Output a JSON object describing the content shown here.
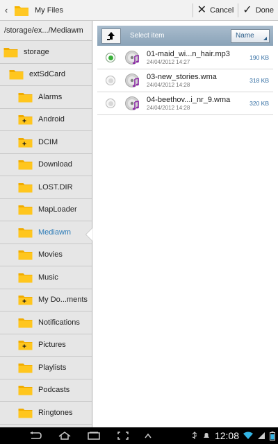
{
  "app": {
    "title": "My Files",
    "cancel_label": "Cancel",
    "done_label": "Done"
  },
  "tree": {
    "path": "/storage/ex.../Mediawm",
    "items": [
      {
        "label": "storage",
        "level": 0,
        "plus": false,
        "selected": false
      },
      {
        "label": "extSdCard",
        "level": 1,
        "plus": false,
        "selected": false
      },
      {
        "label": "Alarms",
        "level": 2,
        "plus": false,
        "selected": false
      },
      {
        "label": "Android",
        "level": 2,
        "plus": true,
        "selected": false
      },
      {
        "label": "DCIM",
        "level": 2,
        "plus": true,
        "selected": false
      },
      {
        "label": "Download",
        "level": 2,
        "plus": false,
        "selected": false
      },
      {
        "label": "LOST.DIR",
        "level": 2,
        "plus": false,
        "selected": false
      },
      {
        "label": "MapLoader",
        "level": 2,
        "plus": false,
        "selected": false
      },
      {
        "label": "Mediawm",
        "level": 2,
        "plus": false,
        "selected": true
      },
      {
        "label": "Movies",
        "level": 2,
        "plus": false,
        "selected": false
      },
      {
        "label": "Music",
        "level": 2,
        "plus": false,
        "selected": false
      },
      {
        "label": "My Do...ments",
        "level": 2,
        "plus": true,
        "selected": false
      },
      {
        "label": "Notifications",
        "level": 2,
        "plus": false,
        "selected": false
      },
      {
        "label": "Pictures",
        "level": 2,
        "plus": true,
        "selected": false
      },
      {
        "label": "Playlists",
        "level": 2,
        "plus": false,
        "selected": false
      },
      {
        "label": "Podcasts",
        "level": 2,
        "plus": false,
        "selected": false
      },
      {
        "label": "Ringtones",
        "level": 2,
        "plus": false,
        "selected": false
      }
    ]
  },
  "list": {
    "header_label": "Select item",
    "sort_label": "Name",
    "files": [
      {
        "name": "01-maid_wi...n_hair.mp3",
        "date": "24/04/2012 14:27",
        "size": "190 KB",
        "selected": true
      },
      {
        "name": "03-new_stories.wma",
        "date": "24/04/2012 14:28",
        "size": "318 KB",
        "selected": false
      },
      {
        "name": "04-beethov...i_nr_9.wma",
        "date": "24/04/2012 14:28",
        "size": "320 KB",
        "selected": false
      }
    ]
  },
  "status": {
    "time": "12:08"
  },
  "colors": {
    "folder": "#f5b400",
    "selected_text": "#2d7cb8",
    "radio_on": "#3ab03a",
    "header_bar": "#8aa3b8"
  }
}
